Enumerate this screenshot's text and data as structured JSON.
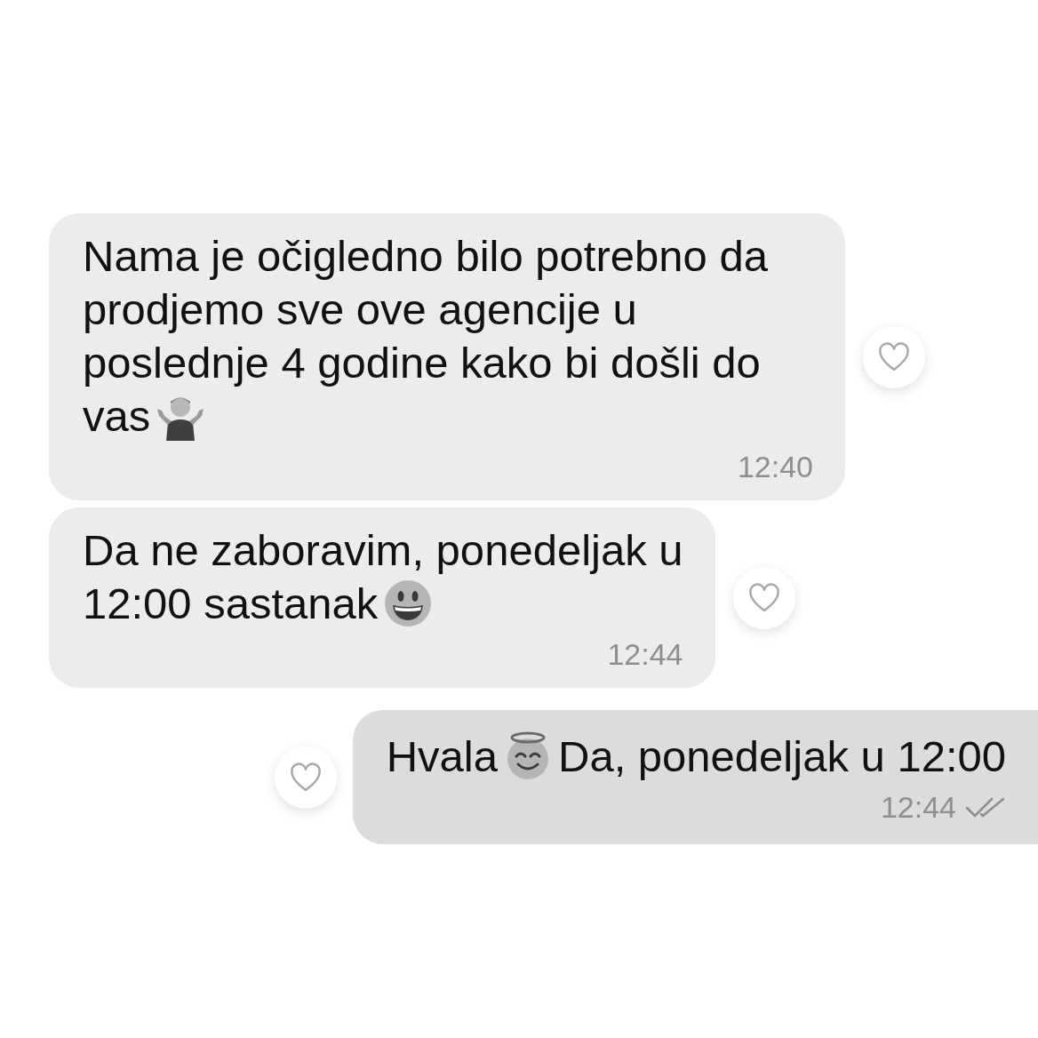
{
  "messages": [
    {
      "outgoing": false,
      "lines": [
        [
          {
            "kind": "text",
            "text": "Nama je očigledno bilo potrebno da prodjemo sve ove agencije u poslednje 4 godine kako bi došli do"
          }
        ],
        [
          {
            "kind": "text",
            "text": "vas"
          },
          {
            "kind": "shrug"
          }
        ]
      ],
      "time": "12:40",
      "liked": false
    },
    {
      "outgoing": false,
      "lines": [
        [
          {
            "kind": "text",
            "text": "Da ne zaboravim, ponedeljak u"
          }
        ],
        [
          {
            "kind": "text",
            "text": "12:00 sastanak"
          },
          {
            "kind": "grin"
          }
        ]
      ],
      "time": "12:44",
      "liked": false
    },
    {
      "outgoing": true,
      "lines": [
        [
          {
            "kind": "text",
            "text": "Hvala"
          },
          {
            "kind": "halo"
          },
          {
            "kind": "text",
            "text": "Da, ponedeljak u 12:00"
          }
        ]
      ],
      "time": "12:44",
      "liked": false,
      "read": true
    }
  ]
}
